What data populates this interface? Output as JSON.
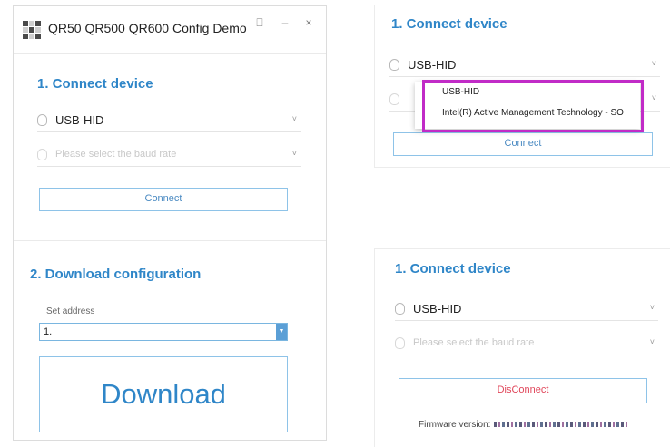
{
  "left_window": {
    "title": "QR50 QR500 QR600 Config Demo",
    "pin_glyph": "⎕",
    "minimize_glyph": "–",
    "close_glyph": "×",
    "section1": {
      "title": "1. Connect device",
      "device_value": "USB-HID",
      "baud_placeholder": "Please select the baud rate",
      "connect_label": "Connect"
    },
    "section2": {
      "title": "2. Download configuration",
      "address_label": "Set address",
      "address_value": "1.",
      "download_label": "Download"
    }
  },
  "top_right": {
    "title": "1. Connect device",
    "device_value": "USB-HID",
    "dropdown_options": [
      "USB-HID",
      "Intel(R) Active Management Technology - SO"
    ],
    "connect_label": "Connect"
  },
  "bottom_right": {
    "title": "1. Connect device",
    "device_value": "USB-HID",
    "baud_placeholder": "Please select the baud rate",
    "disconnect_label": "DisConnect",
    "firmware_label": "Firmware version:"
  },
  "icons": {
    "chevron": "˅"
  },
  "colors": {
    "accent_blue": "#2f86c8",
    "button_border": "#8ec3e8",
    "highlight_magenta": "#c12bc7",
    "disconnect_red": "#e0465a"
  }
}
